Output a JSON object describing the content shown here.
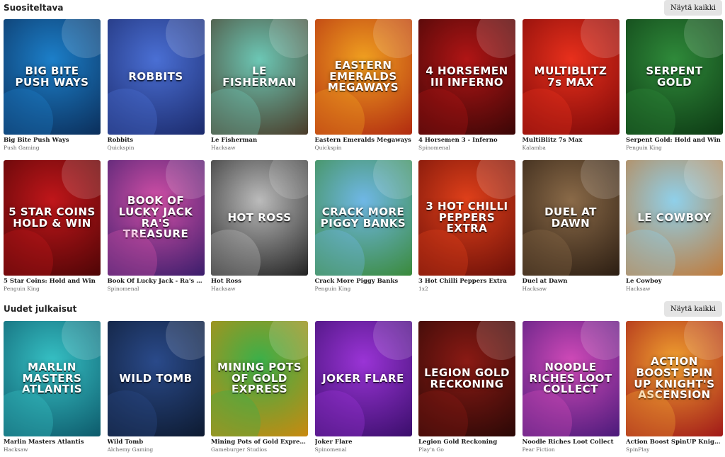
{
  "sections": [
    {
      "title": "Suositeltava",
      "show_all_label": "Näytä kaikki",
      "games": [
        {
          "name": "Big Bite Push Ways",
          "provider": "Push Gaming",
          "logo": "BIG BITE PUSH WAYS",
          "bg1": "#1c7fc9",
          "bg2": "#0b2e5a"
        },
        {
          "name": "Robbits",
          "provider": "Quickspin",
          "logo": "ROBBITS",
          "bg1": "#4a6fd4",
          "bg2": "#1b2a6b"
        },
        {
          "name": "Le Fisherman",
          "provider": "Hacksaw",
          "logo": "LE FISHERMAN",
          "bg1": "#6cc7b5",
          "bg2": "#4a3b28"
        },
        {
          "name": "Eastern Emeralds Megaways",
          "provider": "Quickspin",
          "logo": "EASTERN EMERALDS MEGAWAYS",
          "bg1": "#f0a020",
          "bg2": "#b12a10"
        },
        {
          "name": "4 Horsemen 3 - Inferno",
          "provider": "Spinomenal",
          "logo": "4 HORSEMEN III INFERNO",
          "bg1": "#b01515",
          "bg2": "#3a0606"
        },
        {
          "name": "MultiBlitz 7s Max",
          "provider": "Kalamba",
          "logo": "MULTIBLITZ 7s MAX",
          "bg1": "#e8301c",
          "bg2": "#7a0808"
        },
        {
          "name": "Serpent Gold: Hold and Win",
          "provider": "Penguin King",
          "logo": "SERPENT GOLD",
          "bg1": "#2f8a3a",
          "bg2": "#0d3a14"
        }
      ]
    },
    {
      "title": "",
      "show_all_label": "",
      "games": [
        {
          "name": "5 Star Coins: Hold and Win",
          "provider": "Penguin King",
          "logo": "5 STAR COINS HOLD & WIN",
          "bg1": "#c0161a",
          "bg2": "#4e0506"
        },
        {
          "name": "Book Of Lucky Jack - Ra's Treasure",
          "provider": "Spinomenal",
          "logo": "BOOK OF LUCKY JACK RA'S TREASURE",
          "bg1": "#d14fa6",
          "bg2": "#3a1d6b"
        },
        {
          "name": "Hot Ross",
          "provider": "Hacksaw",
          "logo": "HOT ROSS",
          "bg1": "#bbbbbb",
          "bg2": "#222222"
        },
        {
          "name": "Crack More Piggy Banks",
          "provider": "Penguin King",
          "logo": "CRACK MORE PIGGY BANKS",
          "bg1": "#6fb7e6",
          "bg2": "#3a8a3a"
        },
        {
          "name": "3 Hot Chilli Peppers Extra",
          "provider": "1x2",
          "logo": "3 HOT CHILLI PEPPERS EXTRA",
          "bg1": "#e0401a",
          "bg2": "#6a0f08"
        },
        {
          "name": "Duel at Dawn",
          "provider": "Hacksaw",
          "logo": "DUEL AT DAWN",
          "bg1": "#8a6a48",
          "bg2": "#2b1d12"
        },
        {
          "name": "Le Cowboy",
          "provider": "Hacksaw",
          "logo": "LE COWBOY",
          "bg1": "#8fd0ea",
          "bg2": "#c07a3a"
        }
      ]
    },
    {
      "title": "Uudet julkaisut",
      "show_all_label": "Näytä kaikki",
      "games": [
        {
          "name": "Marlin Masters Atlantis",
          "provider": "Hacksaw",
          "logo": "MARLIN MASTERS ATLANTIS",
          "bg1": "#36c0c4",
          "bg2": "#0d5a6b"
        },
        {
          "name": "Wild Tomb",
          "provider": "Alchemy Gaming",
          "logo": "WILD TOMB",
          "bg1": "#2a4a8a",
          "bg2": "#0d1a30"
        },
        {
          "name": "Mining Pots of Gold Express Gold ...",
          "provider": "Gameburger Studios",
          "logo": "MINING POTS OF GOLD EXPRESS",
          "bg1": "#3ab04a",
          "bg2": "#c9890f"
        },
        {
          "name": "Joker Flare",
          "provider": "Spinomenal",
          "logo": "JOKER FLARE",
          "bg1": "#9a34d6",
          "bg2": "#3a0e6b"
        },
        {
          "name": "Legion Gold Reckoning",
          "provider": "Play'n Go",
          "logo": "LEGION GOLD RECKONING",
          "bg1": "#8a1a14",
          "bg2": "#2a0806"
        },
        {
          "name": "Noodle Riches Loot Collect",
          "provider": "Pear Fiction",
          "logo": "NOODLE RICHES LOOT COLLECT",
          "bg1": "#d04ab8",
          "bg2": "#4a1a7a"
        },
        {
          "name": "Action Boost SpinUP Knight's Asc...",
          "provider": "SpinPlay",
          "logo": "ACTION BOOST SPIN UP KNIGHT'S ASCENSION",
          "bg1": "#f0a030",
          "bg2": "#a01818"
        }
      ]
    }
  ]
}
